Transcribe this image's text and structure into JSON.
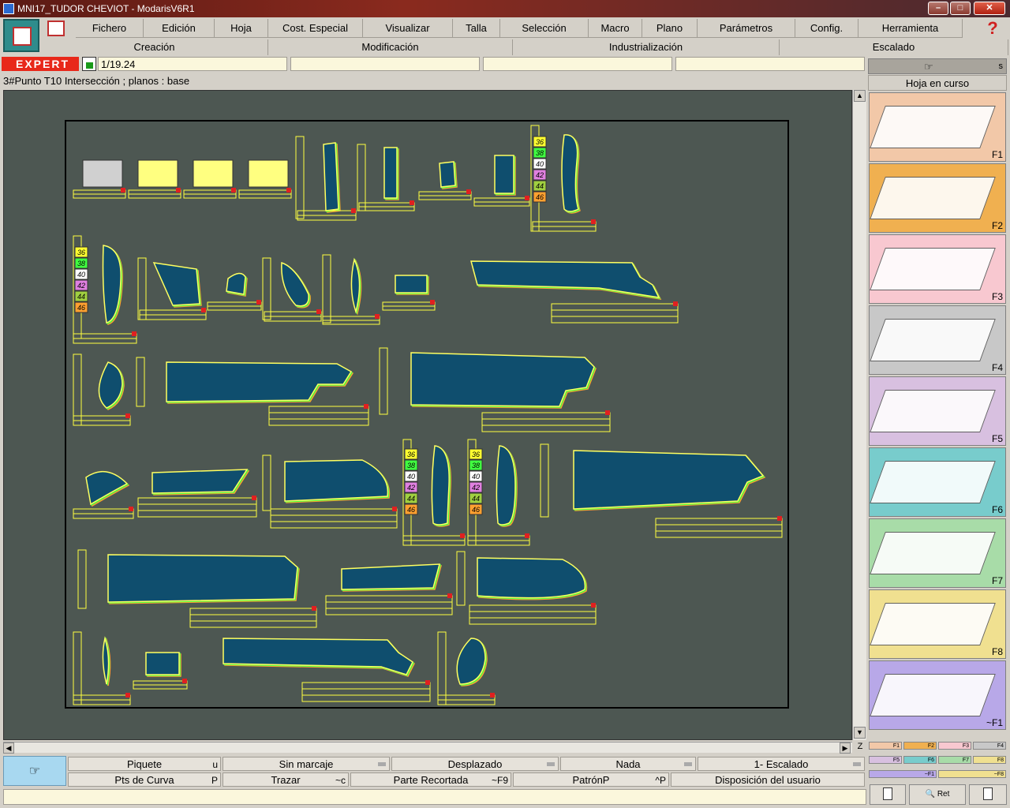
{
  "window": {
    "title": "MNI17_TUDOR CHEVIOT - ModarisV6R1"
  },
  "menu": {
    "items": [
      "Fichero",
      "Edición",
      "Hoja",
      "Cost. Especial",
      "Visualizar",
      "Talla",
      "Selección",
      "Macro",
      "Plano",
      "Parámetros",
      "Config.",
      "Herramienta"
    ],
    "help_icon": "?",
    "submenus": [
      "Creación",
      "Modificación",
      "Industrialización",
      "Escalado"
    ]
  },
  "toolbar": {
    "mode_label": "EXPERT",
    "scale_value": "1/19.24",
    "status_text": "3#Punto T10 Intersección ;    planos :  base"
  },
  "right_panel": {
    "header_letter": "s",
    "title": "Hoja en curso",
    "fkeys": [
      {
        "label": "F1",
        "color": "#f2c8a8"
      },
      {
        "label": "F2",
        "color": "#f0b050"
      },
      {
        "label": "F3",
        "color": "#f8c8d0"
      },
      {
        "label": "F4",
        "color": "#c8c8c8"
      },
      {
        "label": "F5",
        "color": "#d8c0e0"
      },
      {
        "label": "F6",
        "color": "#78cccc"
      },
      {
        "label": "F7",
        "color": "#a8dca8"
      },
      {
        "label": "F8",
        "color": "#f0e090"
      },
      {
        "label": "~F1",
        "color": "#b8a8e8"
      }
    ],
    "mini_keys_row1": [
      "F1",
      "F2",
      "F3",
      "F4"
    ],
    "mini_keys_row2": [
      "F5",
      "F6",
      "F7",
      "F8"
    ],
    "mini_keys_row3": [
      "~F1",
      "~F8"
    ],
    "zoom_label": "Ret"
  },
  "canvas": {
    "size_tags": [
      "36",
      "38",
      "40",
      "42",
      "44",
      "46"
    ],
    "size_colors": [
      "#ffff30",
      "#40ff40",
      "#ffffff",
      "#e080e0",
      "#a0d040",
      "#ffa030"
    ]
  },
  "scrollbar": {
    "z_label": "Z"
  },
  "bottom": {
    "row1": [
      {
        "label": "Piquete",
        "shortcut": "u",
        "dropdown": false
      },
      {
        "label": "Sin marcaje",
        "shortcut": "",
        "dropdown": true
      },
      {
        "label": "Desplazado",
        "shortcut": "",
        "dropdown": true
      },
      {
        "label": "Nada",
        "shortcut": "",
        "dropdown": true
      },
      {
        "label": "1- Escalado",
        "shortcut": "",
        "dropdown": true
      }
    ],
    "row2": [
      {
        "label": "Pts de Curva",
        "shortcut": "P"
      },
      {
        "label": "Trazar",
        "shortcut": "~c"
      },
      {
        "label": "Parte Recortada",
        "shortcut": "~F9"
      },
      {
        "label": "PatrónP",
        "shortcut": "^P"
      },
      {
        "label": "Disposición del usuario",
        "shortcut": ""
      }
    ]
  }
}
